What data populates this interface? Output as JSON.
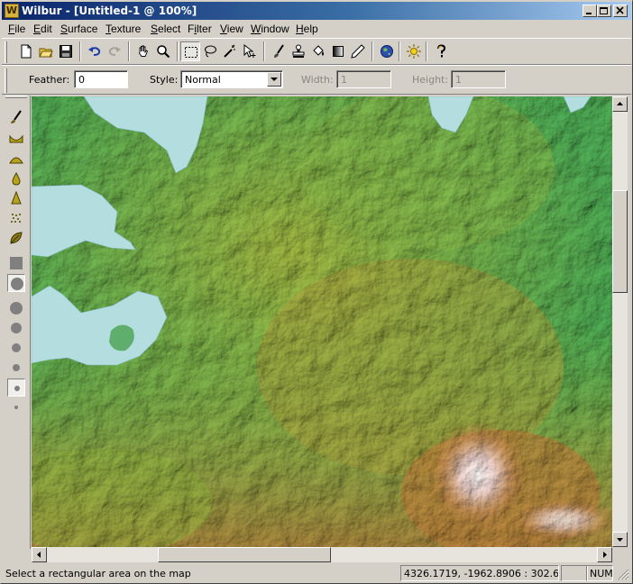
{
  "window": {
    "title": "Wilbur - [Untitled-1 @ 100%]",
    "app_icon_letter": "W",
    "caption_buttons": [
      "minimize",
      "restore",
      "close"
    ]
  },
  "menu": [
    "File",
    "Edit",
    "Surface",
    "Texture",
    "Select",
    "Filter",
    "View",
    "Window",
    "Help"
  ],
  "menu_underline": [
    "F",
    "E",
    "S",
    "T",
    "S",
    "i",
    "V",
    "W",
    "H"
  ],
  "toolbar": {
    "icons": [
      "new-document-icon",
      "open-folder-icon",
      "save-disk-icon",
      "undo-icon",
      "redo-icon",
      "hand-pan-icon",
      "zoom-magnifier-icon",
      "rectangle-select-icon",
      "lasso-select-icon",
      "magic-wand-icon",
      "move-selection-icon",
      "brush-icon",
      "stamp-icon",
      "bucket-fill-icon",
      "gradient-icon",
      "eraser-pencil-icon",
      "globe-render-icon",
      "sun-lighting-icon",
      "help-question-icon"
    ],
    "pressed": "rectangle-select-icon"
  },
  "options": {
    "feather_label": "Feather:",
    "feather_value": "0",
    "style_label": "Style:",
    "style_value": "Normal",
    "width_label": "Width:",
    "width_value": "1",
    "height_label": "Height:",
    "height_value": "1"
  },
  "left_tools": [
    "paint-brush-icon",
    "valley-tool-icon",
    "hill-tool-icon",
    "drop-tool-icon",
    "peak-tool-icon",
    "noise-tool-icon",
    "leaf-tool-icon",
    "square-brush-icon",
    "circle-brush-large-icon",
    "circle-brush-size-1-icon",
    "circle-brush-size-2-icon",
    "circle-brush-size-3-icon",
    "circle-brush-size-4-icon",
    "circle-brush-size-5-icon",
    "circle-brush-size-6-icon"
  ],
  "left_tools_pressed": [
    "circle-brush-large-icon",
    "circle-brush-size-5-icon"
  ],
  "colors": {
    "title_active": "#0a246a",
    "title_gradient_end": "#a6caf0",
    "chrome": "#d4d0c8",
    "water": "#b4dde0",
    "lowland": "#3f9e4f",
    "midland": "#8aab3a",
    "highland": "#b07a36",
    "peak": "#e8e2e0"
  },
  "status": {
    "message": "Select a rectangular area on the map",
    "coordinates": "4326.1719, -1962.8906 : 302.6900",
    "indicator_num": "NUM"
  }
}
